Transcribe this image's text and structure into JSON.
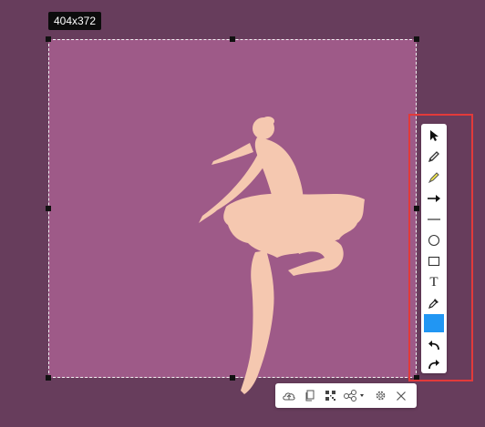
{
  "selection": {
    "size_label": "404x372",
    "image_fill": "#9e5a88",
    "silhouette_color": "#f5c8b0"
  },
  "toolbar": {
    "tools": [
      {
        "icon": "pointer-icon"
      },
      {
        "icon": "pencil-icon"
      },
      {
        "icon": "highlighter-icon"
      },
      {
        "icon": "arrow-icon"
      },
      {
        "icon": "line-icon"
      },
      {
        "icon": "ellipse-icon"
      },
      {
        "icon": "rectangle-icon"
      },
      {
        "icon": "text-icon",
        "label": "T"
      },
      {
        "icon": "eyedropper-icon"
      },
      {
        "icon": "color-swatch",
        "color": "#2196f3"
      },
      {
        "icon": "undo-icon"
      },
      {
        "icon": "redo-icon"
      }
    ],
    "highlight_color": "#e23a3a"
  },
  "bottom_bar": {
    "buttons": [
      {
        "icon": "cloud-upload-icon"
      },
      {
        "icon": "copy-icon"
      },
      {
        "icon": "qr-code-icon"
      },
      {
        "icon": "share-icon"
      },
      {
        "icon": "settings-icon"
      },
      {
        "icon": "close-icon"
      }
    ]
  }
}
